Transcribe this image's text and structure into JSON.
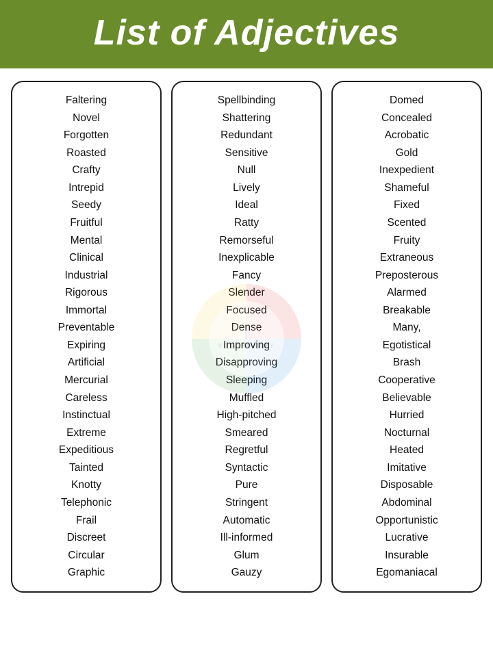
{
  "header": {
    "title": "List of Adjectives"
  },
  "columns": [
    {
      "id": "col1",
      "words": [
        "Faltering",
        "Novel",
        "Forgotten",
        "Roasted",
        "Crafty",
        "Intrepid",
        "Seedy",
        "Fruitful",
        "Mental",
        "Clinical",
        "Industrial",
        "Rigorous",
        "Immortal",
        "Preventable",
        "Expiring",
        "Artificial",
        "Mercurial",
        "Careless",
        "Instinctual",
        "Extreme",
        "Expeditious",
        "Tainted",
        "Knotty",
        "Telephonic",
        "Frail",
        "Discreet",
        "Circular",
        "Graphic"
      ]
    },
    {
      "id": "col2",
      "words": [
        "Spellbinding",
        "Shattering",
        "Redundant",
        "Sensitive",
        "Null",
        "Lively",
        "Ideal",
        "Ratty",
        "Remorseful",
        "Inexplicable",
        "Fancy",
        "Slender",
        "Focused",
        "Dense",
        "Improving",
        "Disapproving",
        "Sleeping",
        "Muffled",
        "High-pitched",
        "Smeared",
        "Regretful",
        "Syntactic",
        "Pure",
        "Stringent",
        "Automatic",
        "Ill-informed",
        "Glum",
        "Gauzy"
      ]
    },
    {
      "id": "col3",
      "words": [
        "Domed",
        "Concealed",
        "Acrobatic",
        "Gold",
        "Inexpedient",
        "Shameful",
        "Fixed",
        "Scented",
        "Fruity",
        "Extraneous",
        "Preposterous",
        "Alarmed",
        "Breakable",
        "Many,",
        "Egotistical",
        "Brash",
        "Cooperative",
        "Believable",
        "Hurried",
        "Nocturnal",
        "Heated",
        "Imitative",
        "Disposable",
        "Abdominal",
        "Opportunistic",
        "Lucrative",
        "Insurable",
        "Egomaniacal"
      ]
    }
  ],
  "watermark": {
    "line1": "I",
    "line2": "VOCABULARY"
  }
}
